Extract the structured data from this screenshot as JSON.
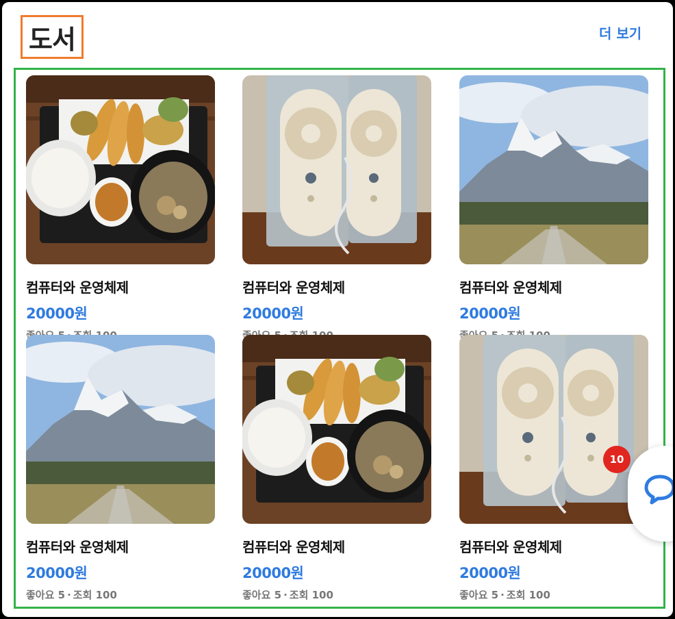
{
  "section": {
    "title": "도서",
    "more_label": "더 보기"
  },
  "products": [
    {
      "image": "tempura-meal",
      "name": "컴퓨터와 운영체제",
      "price": "20000원",
      "likes": "좋아요 5",
      "views": "조회 100"
    },
    {
      "image": "handheld-fan-pack",
      "name": "컴퓨터와 운영체제",
      "price": "20000원",
      "likes": "좋아요 5",
      "views": "조회 100"
    },
    {
      "image": "mountain-road",
      "name": "컴퓨터와 운영체제",
      "price": "20000원",
      "likes": "좋아요 5",
      "views": "조회 100"
    },
    {
      "image": "mountain-road",
      "name": "컴퓨터와 운영체제",
      "price": "20000원",
      "likes": "좋아요 5",
      "views": "조회 100"
    },
    {
      "image": "tempura-meal",
      "name": "컴퓨터와 운영체제",
      "price": "20000원",
      "likes": "좋아요 5",
      "views": "조회 100"
    },
    {
      "image": "handheld-fan-pack",
      "name": "컴퓨터와 운영체제",
      "price": "20000원",
      "likes": "좋아요 5",
      "views": "조회 100",
      "badge": "10"
    }
  ],
  "meta_separator": "·",
  "colors": {
    "accent": "#2f7be0",
    "title_outline": "#f07a2c",
    "grid_outline": "#33b24a",
    "badge": "#e0261f"
  },
  "icons": {
    "chat": "chat-bubble-icon"
  }
}
